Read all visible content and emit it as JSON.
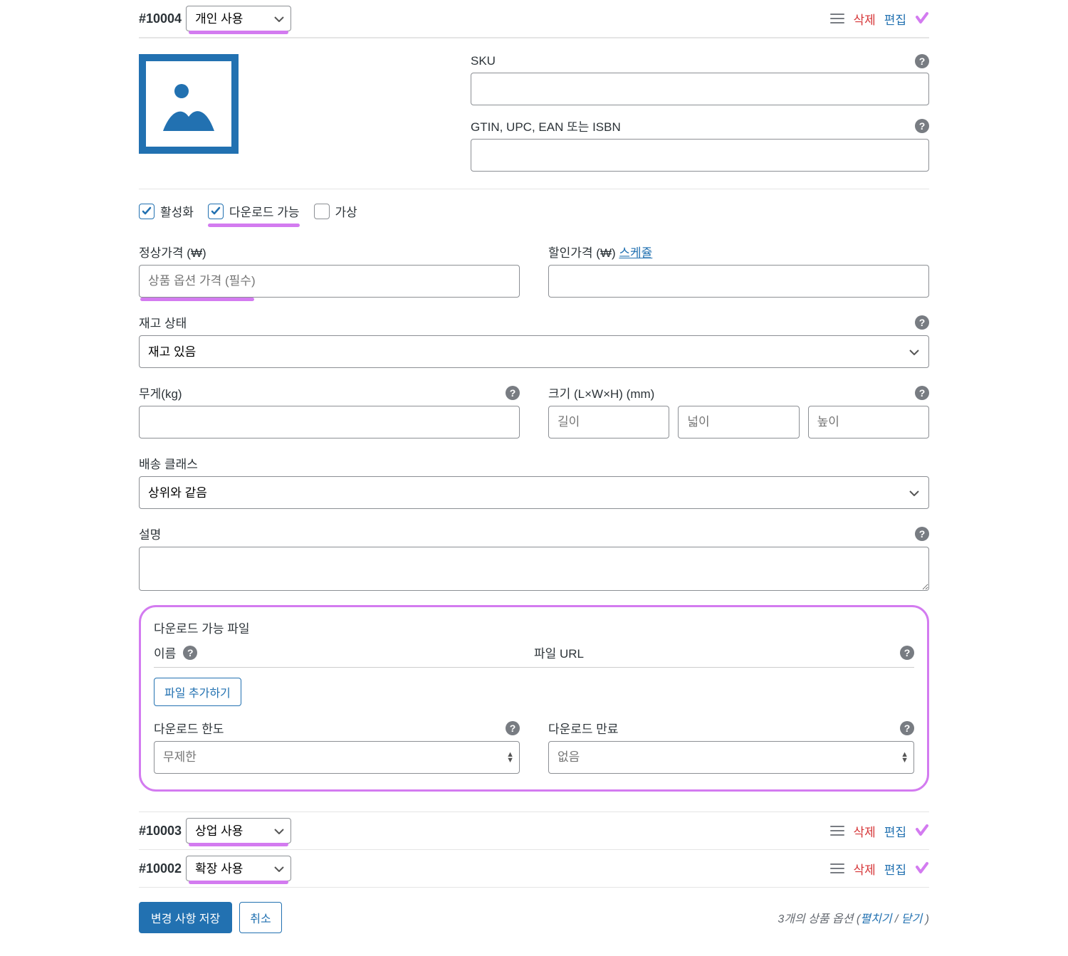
{
  "variations": [
    {
      "id": "#10004",
      "select": "개인 사용",
      "delete": "삭제",
      "edit": "편집"
    },
    {
      "id": "#10003",
      "select": "상업 사용",
      "delete": "삭제",
      "edit": "편집"
    },
    {
      "id": "#10002",
      "select": "확장 사용",
      "delete": "삭제",
      "edit": "편집"
    }
  ],
  "sku": {
    "label": "SKU"
  },
  "gtin": {
    "label": "GTIN, UPC, EAN 또는 ISBN"
  },
  "checkboxes": {
    "active": "활성화",
    "downloadable": "다운로드 가능",
    "virtual": "가상"
  },
  "regular_price": {
    "label": "정상가격 (₩)",
    "placeholder": "상품 옵션 가격 (필수)"
  },
  "sale_price": {
    "label": "할인가격 (₩)",
    "schedule": "스케쥴"
  },
  "stock": {
    "label": "재고 상태",
    "value": "재고 있음"
  },
  "weight": {
    "label": "무게(kg)"
  },
  "dimensions": {
    "label": "크기 (L×W×H) (mm)",
    "length": "길이",
    "width": "넓이",
    "height": "높이"
  },
  "shipping": {
    "label": "배송 클래스",
    "value": "상위와 같음"
  },
  "description": {
    "label": "설명"
  },
  "download": {
    "title": "다운로드 가능 파일",
    "name_col": "이름",
    "url_col": "파일 URL",
    "add_file": "파일 추가하기",
    "limit": {
      "label": "다운로드 한도",
      "placeholder": "무제한"
    },
    "expiry": {
      "label": "다운로드 만료",
      "placeholder": "없음"
    }
  },
  "footer": {
    "save": "변경 사항 저장",
    "cancel": "취소",
    "count_prefix": "3개의 상품 옵션 (",
    "expand": "펼치기",
    "sep": " / ",
    "collapse": "닫기",
    "suffix": " )"
  }
}
